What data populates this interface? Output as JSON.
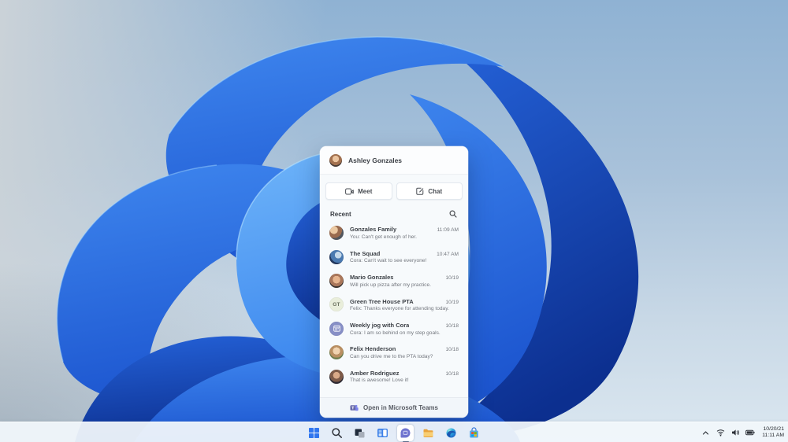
{
  "flyout": {
    "user": {
      "name": "Ashley Gonzales"
    },
    "actions": {
      "meet_label": "Meet",
      "chat_label": "Chat"
    },
    "recent_label": "Recent",
    "chats": [
      {
        "name": "Gonzales Family",
        "preview": "You: Can't get enough of her.",
        "time": "11:09 AM",
        "avatar": "group-photo"
      },
      {
        "name": "The Squad",
        "preview": "Cora: Can't wait to see everyone!",
        "time": "10:47 AM",
        "avatar": "group-photo"
      },
      {
        "name": "Mario Gonzales",
        "preview": "Will pick up pizza after my practice.",
        "time": "10/19",
        "avatar": "photo"
      },
      {
        "name": "Green Tree House PTA",
        "preview": "Felix: Thanks everyone for attending today.",
        "time": "10/19",
        "avatar": "initials",
        "initials": "GT"
      },
      {
        "name": "Weekly jog with Cora",
        "preview": "Cora: I am so behind on my step goals.",
        "time": "10/18",
        "avatar": "calendar-icon"
      },
      {
        "name": "Felix Henderson",
        "preview": "Can you drive me to the PTA today?",
        "time": "10/18",
        "avatar": "photo"
      },
      {
        "name": "Amber Rodriguez",
        "preview": "That is awesome! Love it!",
        "time": "10/18",
        "avatar": "photo"
      }
    ],
    "footer": {
      "label": "Open in Microsoft Teams"
    }
  },
  "taskbar": {
    "icons": [
      "start",
      "search",
      "task-view",
      "widgets",
      "chat",
      "file-explorer",
      "edge",
      "store"
    ],
    "active_icon": "chat",
    "tray_icons": [
      "hidden-icons-chevron",
      "wifi",
      "volume",
      "battery"
    ],
    "clock": {
      "date": "10/20/21",
      "time": "11:11 AM"
    }
  },
  "colors": {
    "bloom_blue_light": "#6fb5f9",
    "bloom_blue_mid": "#2a6fe4",
    "bloom_blue_deep": "#0c2f8f",
    "teams_purple": "#6264a7",
    "taskbar_bg": "#f1f6fb",
    "flyout_bg": "#f7fafc"
  }
}
